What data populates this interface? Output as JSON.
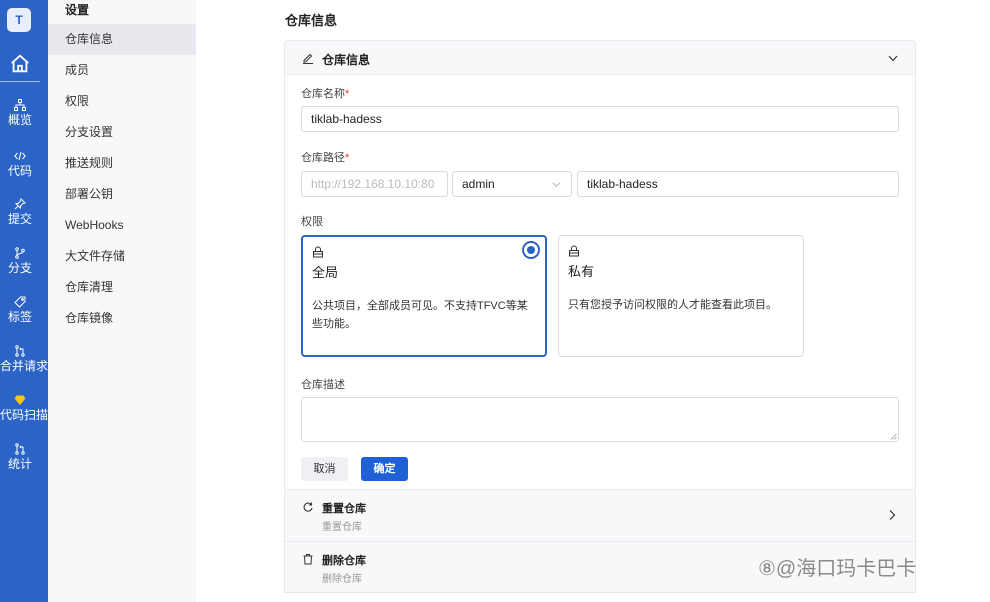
{
  "rail": {
    "avatar": "T",
    "items": [
      {
        "label": "概览",
        "icon": "sitemap-icon"
      },
      {
        "label": "代码",
        "icon": "code-icon"
      },
      {
        "label": "提交",
        "icon": "pin-icon"
      },
      {
        "label": "分支",
        "icon": "branch-icon"
      },
      {
        "label": "标签",
        "icon": "tag-icon"
      },
      {
        "label": "合并请求",
        "icon": "merge-icon"
      },
      {
        "label": "代码扫描",
        "icon": "diamond-icon"
      },
      {
        "label": "统计",
        "icon": "stats-icon"
      }
    ]
  },
  "submenu": {
    "heading": "设置",
    "items": [
      "仓库信息",
      "成员",
      "权限",
      "分支设置",
      "推送规则",
      "部署公钥",
      "WebHooks",
      "大文件存储",
      "仓库清理",
      "仓库镜像"
    ],
    "active_index": 0
  },
  "page": {
    "title": "仓库信息"
  },
  "card": {
    "title": "仓库信息",
    "name_label": "仓库名称",
    "name_value": "tiklab-hadess",
    "path_label": "仓库路径",
    "path_prefix_placeholder": "http://192.168.10.10:80",
    "path_owner": "admin",
    "path_name": "tiklab-hadess",
    "perm_label": "权限",
    "perm_options": [
      {
        "name": "全局",
        "desc_line1": "公共项目，全部成员可见。不支持TFVC等某",
        "desc_line2": "些功能。",
        "selected": true
      },
      {
        "name": "私有",
        "desc_line1": "只有您授予访问权限的人才能查看此项目。",
        "desc_line2": "",
        "selected": false
      }
    ],
    "desc_label": "仓库描述",
    "desc_value": "",
    "cancel_label": "取消",
    "ok_label": "确定"
  },
  "sections": [
    {
      "title": "重置仓库",
      "subtitle": "重置仓库",
      "icon": "reset-icon"
    },
    {
      "title": "删除仓库",
      "subtitle": "删除仓库",
      "icon": "trash-icon"
    }
  ],
  "watermark": "⑧@海口玛卡巴卡",
  "colors": {
    "rail": "#2b63c7",
    "primary": "#1f60d4",
    "required": "#e33333"
  }
}
